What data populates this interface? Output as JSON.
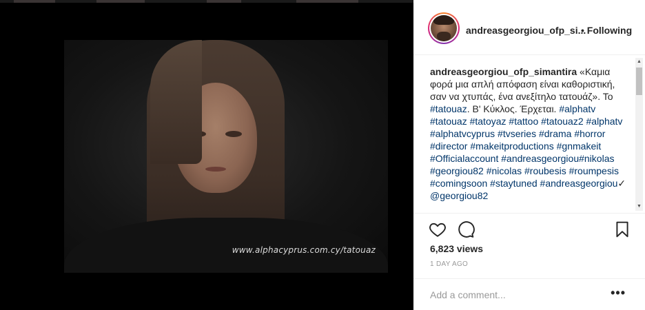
{
  "media": {
    "watermark": "www.alphacyprus.com.cy/tatouaz"
  },
  "header": {
    "username": "andreasgeorgiou_ofp_si...",
    "bullet": "•",
    "follow_label": "Following"
  },
  "caption": {
    "username": "andreasgeorgiou_ofp_simantira",
    "text_1": " «Καμια φορά μια απλή απόφαση είναι καθοριστική, σαν να χτυπάς, ένα ανεξίτηλο τατουάζ». Το ",
    "tag_1": "#tatouaz",
    "text_2": ". Β' Κύκλος. Έρχεται. ",
    "tags_1": "#alphatv #tatouaz #tatoyaz #tattoo #tatouaz2 #alphatv #alphatvcyprus #tvseries #drama #horror #director #makeitproductions #gnmakeit #Officialaccount #andreasgeorgiou#nikolas #georgiou82 #nicolas #roubesis #roumpesis #comingsoon #staytuned #andreasgeorgiou",
    "check": "✓ ",
    "mention": "@georgiou82"
  },
  "stats": {
    "views": "6,823 views",
    "date": "1 DAY AGO"
  },
  "comment": {
    "placeholder": "Add a comment...",
    "more": "•••"
  },
  "icons": {
    "like": "heart-icon",
    "comment": "comment-bubble-icon",
    "save": "bookmark-icon"
  },
  "colors": {
    "hashtag": "#003569",
    "text": "#262626",
    "muted": "#999999"
  }
}
